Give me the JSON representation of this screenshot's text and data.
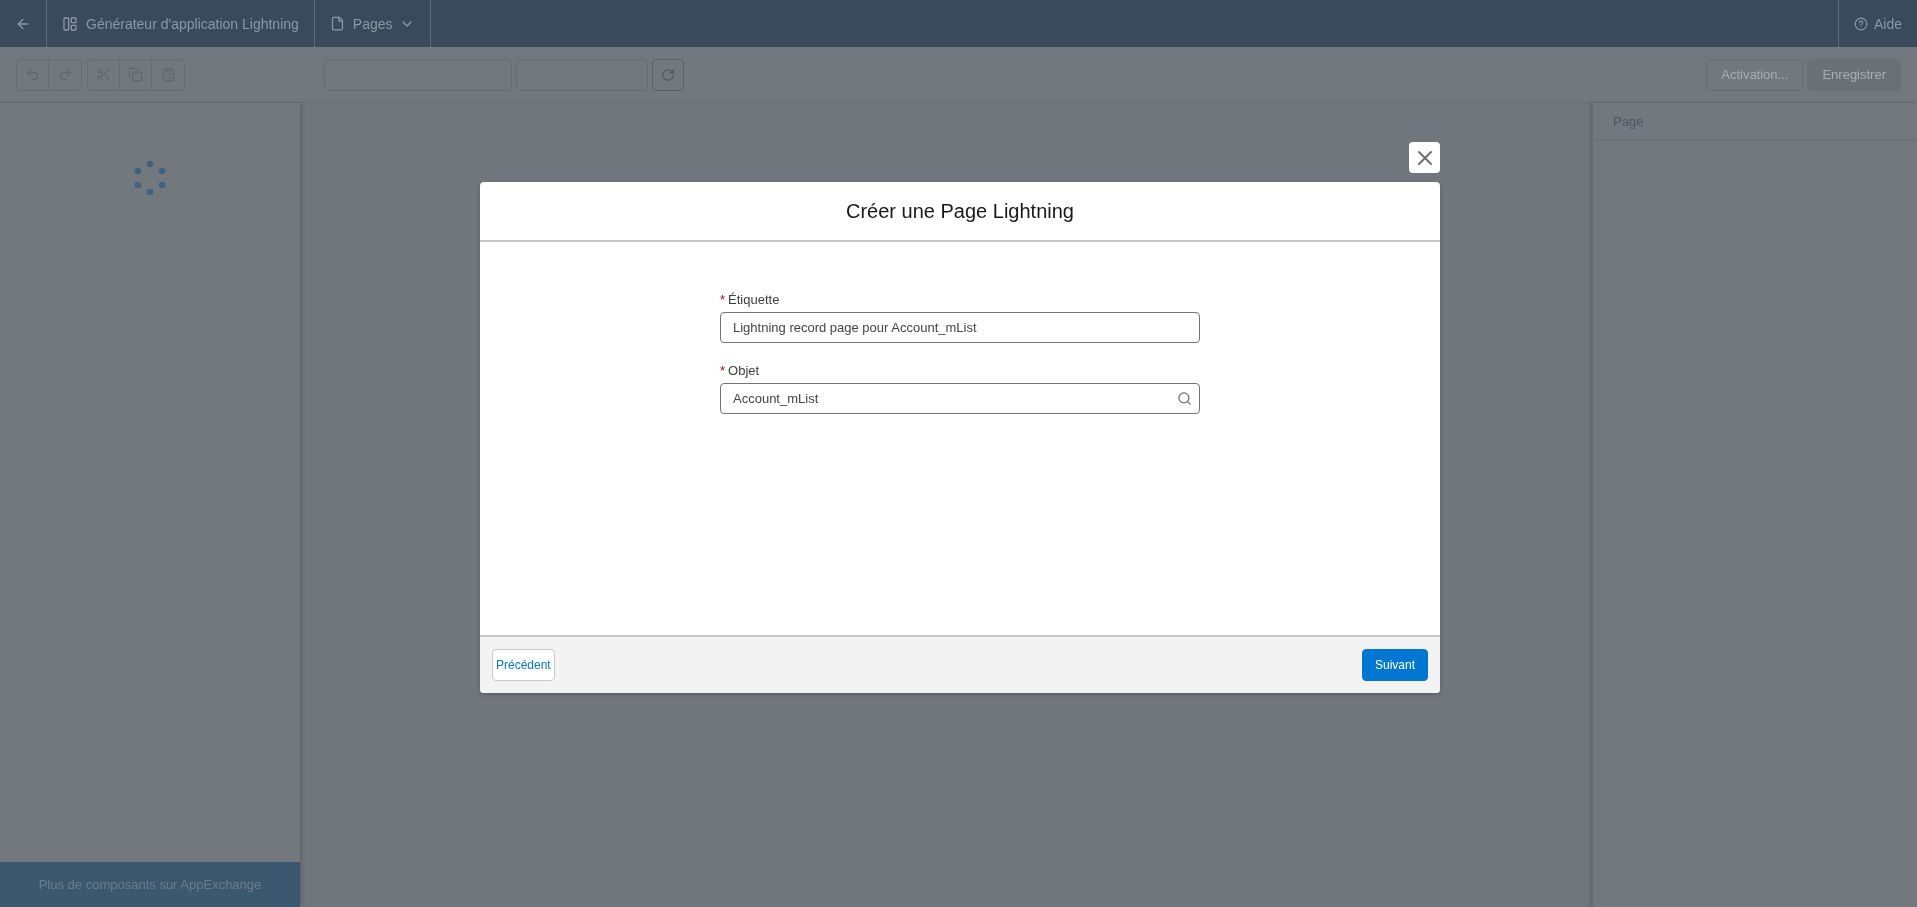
{
  "top_bar": {
    "app_title": "Générateur d'application Lightning",
    "pages_menu": "Pages",
    "help": "Aide"
  },
  "toolbar": {
    "activation_button": "Activation...",
    "save_button": "Enregistrer"
  },
  "left_panel": {
    "footer_link": "Plus de composants sur AppExchange"
  },
  "right_panel": {
    "title": "Page"
  },
  "modal": {
    "title": "Créer une Page Lightning",
    "fields": [
      {
        "kind": "text",
        "required_mark": "*",
        "label": "Étiquette",
        "value": "Lightning record page pour Account_mList"
      },
      {
        "kind": "lookup",
        "required_mark": "*",
        "label": "Objet",
        "value": "Account_mList"
      }
    ],
    "back_button": "Précédent",
    "next_button": "Suivant"
  }
}
